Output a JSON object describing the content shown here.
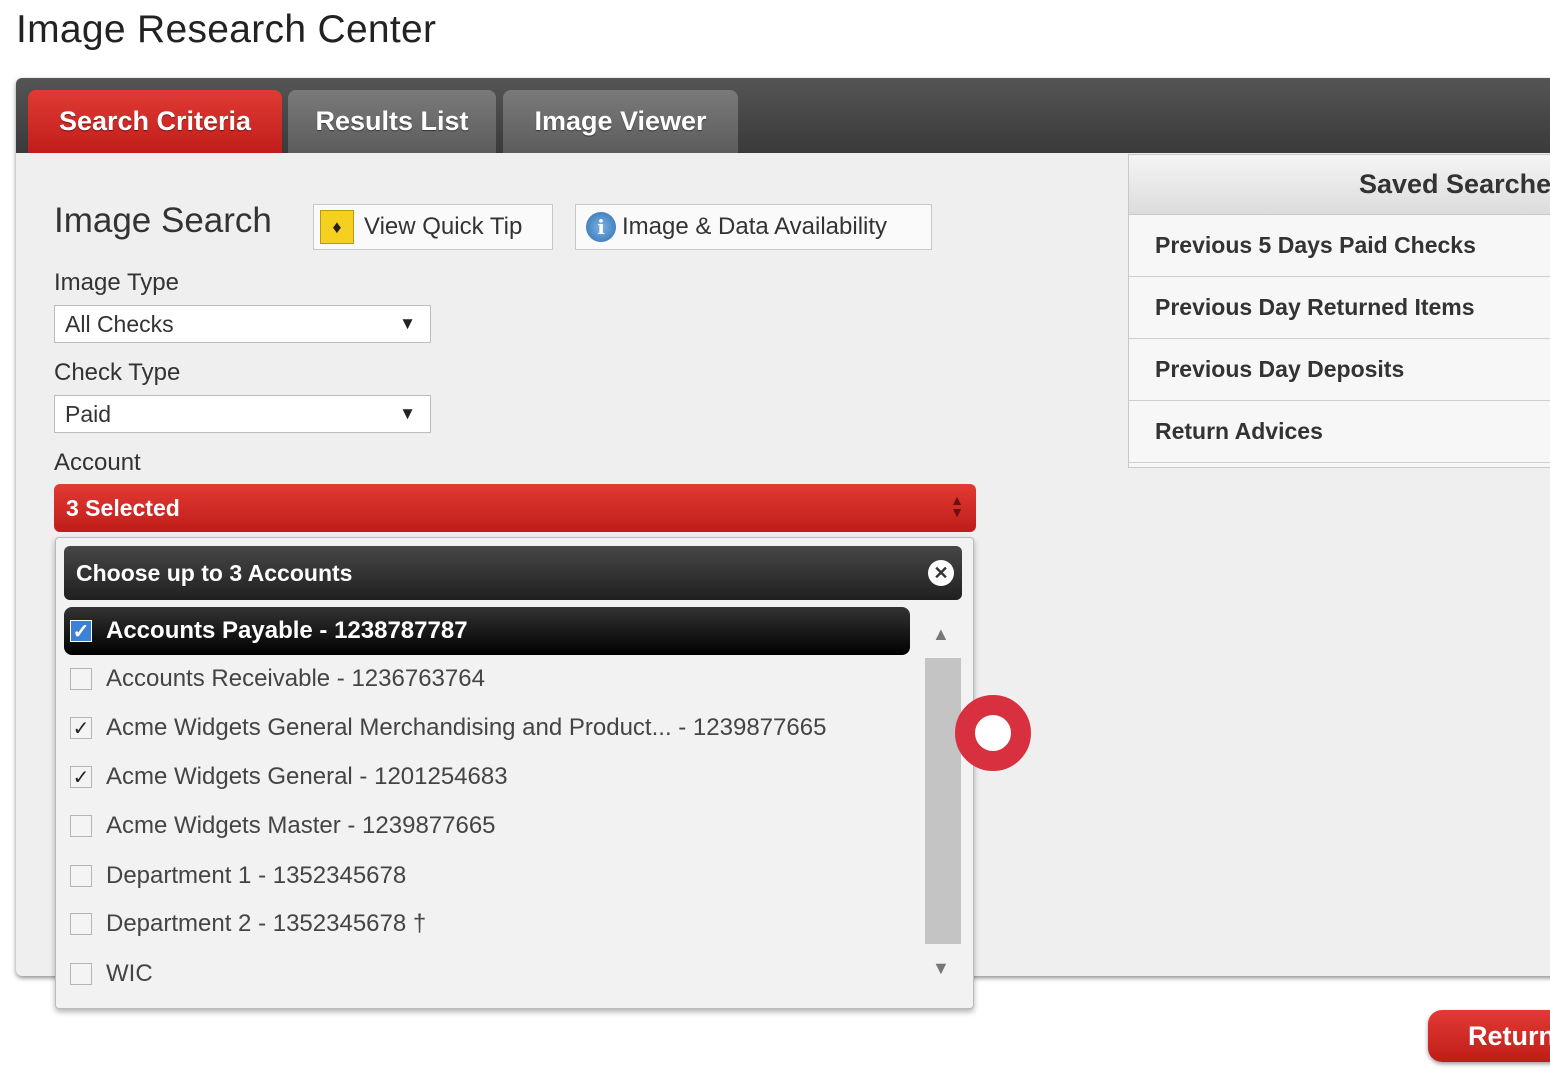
{
  "page": {
    "title": "Image Research Center"
  },
  "tabs": [
    {
      "label": "Search Criteria",
      "active": true
    },
    {
      "label": "Results List",
      "active": false
    },
    {
      "label": "Image Viewer",
      "active": false
    }
  ],
  "search": {
    "heading": "Image Search",
    "quick_tip_label": "View Quick Tip",
    "availability_label": "Image & Data Availability"
  },
  "fields": {
    "image_type": {
      "label": "Image Type",
      "value": "All Checks"
    },
    "check_type": {
      "label": "Check Type",
      "value": "Paid"
    },
    "account": {
      "label": "Account",
      "value": "3 Selected"
    }
  },
  "account_dropdown": {
    "header": "Choose up to 3 Accounts",
    "options": [
      {
        "label": "Accounts Payable - 1238787787",
        "checked": true,
        "highlighted": true
      },
      {
        "label": "Accounts Receivable - 1236763764",
        "checked": false
      },
      {
        "label": "Acme Widgets General Merchandising and Product... - 1239877665",
        "checked": true
      },
      {
        "label": "Acme Widgets General - 1201254683",
        "checked": true
      },
      {
        "label": "Acme Widgets Master - 1239877665",
        "checked": false
      },
      {
        "label": "Department 1 - 1352345678",
        "checked": false
      },
      {
        "label": "Department 2 - 1352345678 †",
        "checked": false
      },
      {
        "label": "WIC",
        "checked": false
      }
    ]
  },
  "saved_searches": {
    "title": "Saved Searche",
    "items": [
      "Previous 5 Days Paid Checks",
      "Previous Day Returned Items",
      "Previous Day Deposits",
      "Return Advices"
    ]
  },
  "footer": {
    "return_label": "Return"
  },
  "colors": {
    "accent": "#d52b27",
    "cursor": "#d8303e",
    "dark": "#1e1e1e"
  }
}
